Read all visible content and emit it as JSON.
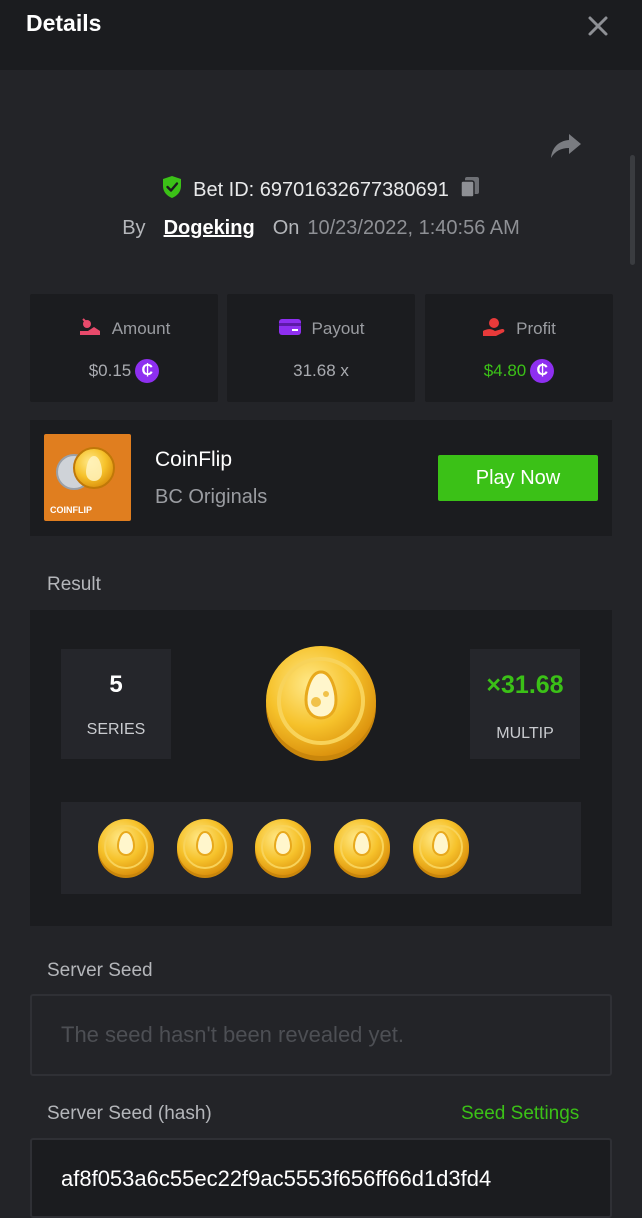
{
  "header": {
    "title": "Details"
  },
  "bet": {
    "id_text": "Bet ID: 69701632677380691",
    "by_label": "By",
    "user": "Dogeking",
    "on_label": "On",
    "datetime": "10/23/2022, 1:40:56 AM"
  },
  "stats": [
    {
      "label": "Amount",
      "value": "$0.15",
      "icon": "amount-icon",
      "value_color": "#a9abb0"
    },
    {
      "label": "Payout",
      "value": "31.68 x",
      "icon": "payout-card-icon",
      "value_color": "#a9abb0"
    },
    {
      "label": "Profit",
      "value": "$4.80",
      "icon": "profit-hand-icon",
      "value_color": "#3bc117"
    }
  ],
  "game": {
    "name": "CoinFlip",
    "provider": "BC Originals",
    "thumb_label": "COINFLIP",
    "play_label": "Play Now"
  },
  "result": {
    "label": "Result",
    "series_value": "5",
    "series_label": "SERIES",
    "multiplier_value": "×31.68",
    "multiplier_label": "MULTIP",
    "coin_count": 5
  },
  "server_seed": {
    "label": "Server Seed",
    "placeholder": "The seed hasn't been revealed yet."
  },
  "server_seed_hash": {
    "label": "Server Seed (hash)",
    "settings_label": "Seed Settings",
    "value": "af8f053a6c55ec22f9ac5553f656ff66d1d3fd4"
  },
  "colors": {
    "accent_green": "#3bc117",
    "coin_purple": "#8e2ff0",
    "background": "#232428",
    "panel": "#1b1c1f"
  }
}
